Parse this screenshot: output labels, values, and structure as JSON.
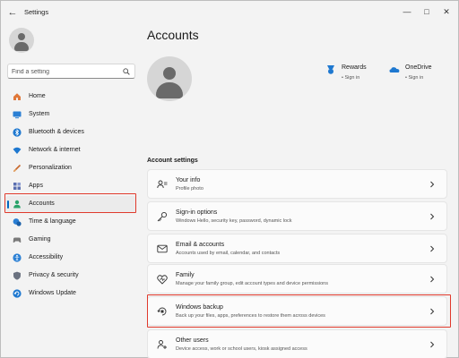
{
  "window": {
    "title": "Settings"
  },
  "sidebar": {
    "search_placeholder": "Find a setting",
    "items": [
      {
        "label": "Home",
        "icon": "home-icon"
      },
      {
        "label": "System",
        "icon": "system-icon"
      },
      {
        "label": "Bluetooth & devices",
        "icon": "bluetooth-icon"
      },
      {
        "label": "Network & internet",
        "icon": "network-icon"
      },
      {
        "label": "Personalization",
        "icon": "personalization-icon"
      },
      {
        "label": "Apps",
        "icon": "apps-icon"
      },
      {
        "label": "Accounts",
        "icon": "accounts-icon",
        "active": true
      },
      {
        "label": "Time & language",
        "icon": "time-language-icon"
      },
      {
        "label": "Gaming",
        "icon": "gaming-icon"
      },
      {
        "label": "Accessibility",
        "icon": "accessibility-icon"
      },
      {
        "label": "Privacy & security",
        "icon": "privacy-icon"
      },
      {
        "label": "Windows Update",
        "icon": "windows-update-icon"
      }
    ]
  },
  "main": {
    "title": "Accounts",
    "services": [
      {
        "name": "Rewards",
        "status": "• Sign in",
        "icon": "rewards-icon"
      },
      {
        "name": "OneDrive",
        "status": "• Sign in",
        "icon": "onedrive-icon"
      }
    ],
    "section_title": "Account settings",
    "cards": [
      {
        "title": "Your info",
        "desc": "Profile photo",
        "icon": "your-info-icon"
      },
      {
        "title": "Sign-in options",
        "desc": "Windows Hello, security key, password, dynamic lock",
        "icon": "key-icon"
      },
      {
        "title": "Email & accounts",
        "desc": "Accounts used by email, calendar, and contacts",
        "icon": "email-icon"
      },
      {
        "title": "Family",
        "desc": "Manage your family group, edit account types and device permissions",
        "icon": "family-icon"
      },
      {
        "title": "Windows backup",
        "desc": "Back up your files, apps, preferences to restore them across devices",
        "icon": "backup-icon"
      },
      {
        "title": "Other users",
        "desc": "Device access, work or school users, kiosk assigned access",
        "icon": "other-users-icon"
      }
    ]
  },
  "colors": {
    "accent": "#0067c0",
    "highlight": "#e03a2c"
  }
}
